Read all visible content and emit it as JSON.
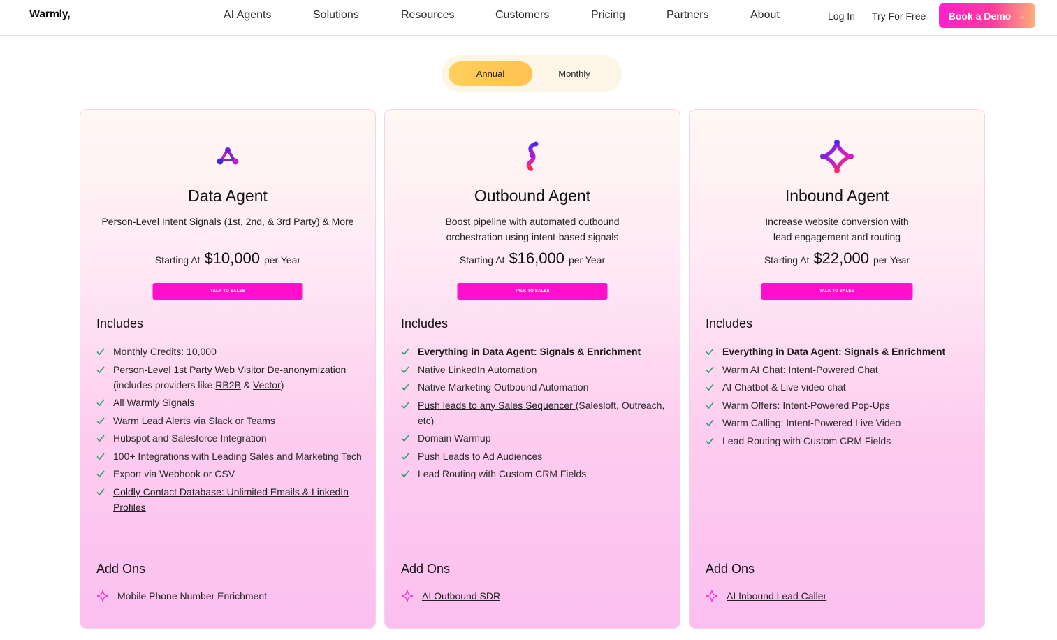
{
  "header": {
    "logo": "Warmly,",
    "nav": [
      "AI Agents",
      "Solutions",
      "Resources",
      "Customers",
      "Pricing",
      "Partners",
      "About"
    ],
    "login": "Log In",
    "try_free": "Try For Free",
    "demo": "Book a Demo",
    "demo_icon": "arrow-right-icon"
  },
  "toggle": {
    "annual": "Annual",
    "monthly": "Monthly",
    "selected": "Annual",
    "active_color": "#ffc853"
  },
  "colors": {
    "brand_pink": "#ff10cc",
    "card_bottom": "#fbbff0",
    "check": "#2f9e6e"
  },
  "plans": [
    {
      "icon": "data-agent-logo-icon",
      "title": "Data Agent",
      "desc_lines": [
        "Person-Level Intent Signals (1st, 2nd, & 3rd Party) & More"
      ],
      "starting": "Starting At",
      "price": "$10,000",
      "period": "per Year",
      "cta": "TALK TO SALES",
      "includes_title": "Includes",
      "features": [
        {
          "text": "Monthly Credits: 10,000"
        },
        {
          "link": "Person-Level 1st Party Web Visitor De-anonymization",
          "text": "(includes providers like ",
          "link2": "RB2B",
          "mid": " & ",
          "link3": "Vector",
          "end": ")"
        },
        {
          "link": "All Warmly Signals"
        },
        {
          "text": "Warm Lead Alerts via Slack or Teams"
        },
        {
          "text": "Hubspot and Salesforce Integration"
        },
        {
          "text": "100+ Integrations with Leading Sales and Marketing Tech"
        },
        {
          "text": "Export via Webhook or CSV"
        },
        {
          "link": "Coldly Contact Database: Unlimited Emails & LinkedIn Profiles"
        }
      ],
      "addons_title": "Add Ons",
      "addon": "Mobile Phone Number Enrichment"
    },
    {
      "icon": "outbound-agent-logo-icon",
      "title": "Outbound Agent",
      "desc_lines": [
        "Boost pipeline with automated outbound",
        "orchestration using intent-based signals"
      ],
      "starting": "Starting At",
      "price": "$16,000",
      "period": "per Year",
      "cta": "TALK TO SALES",
      "includes_title": "Includes",
      "features": [
        {
          "text": "Everything in Data Agent: Signals & Enrichment",
          "bold": true
        },
        {
          "text": "Native LinkedIn Automation"
        },
        {
          "text": "Native Marketing Outbound Automation"
        },
        {
          "link": "Push leads to any Sales Sequencer ",
          "text": "(Salesloft, Outreach, etc)"
        },
        {
          "text": "Domain Warmup"
        },
        {
          "text": "Push Leads to Ad Audiences"
        },
        {
          "text": "Lead Routing with Custom CRM Fields"
        }
      ],
      "addons_title": "Add Ons",
      "addon": "AI Outbound SDR"
    },
    {
      "icon": "inbound-agent-logo-icon",
      "title": "Inbound Agent",
      "desc_lines": [
        "Increase website conversion with",
        "lead engagement and routing"
      ],
      "starting": "Starting At",
      "price": "$22,000",
      "period": "per Year",
      "cta": "TALK TO SALES",
      "includes_title": "Includes",
      "features": [
        {
          "text": "Everything in Data Agent: Signals & Enrichment",
          "bold": true
        },
        {
          "text": "Warm AI Chat: Intent-Powered Chat"
        },
        {
          "text": "AI Chatbot & Live video chat"
        },
        {
          "text": "Warm Offers: Intent-Powered Pop-Ups"
        },
        {
          "text": "Warm Calling: Intent-Powered Live Video"
        },
        {
          "text": "Lead Routing with Custom CRM Fields"
        }
      ],
      "addons_title": "Add Ons",
      "addon": "AI Inbound Lead Caller"
    }
  ]
}
